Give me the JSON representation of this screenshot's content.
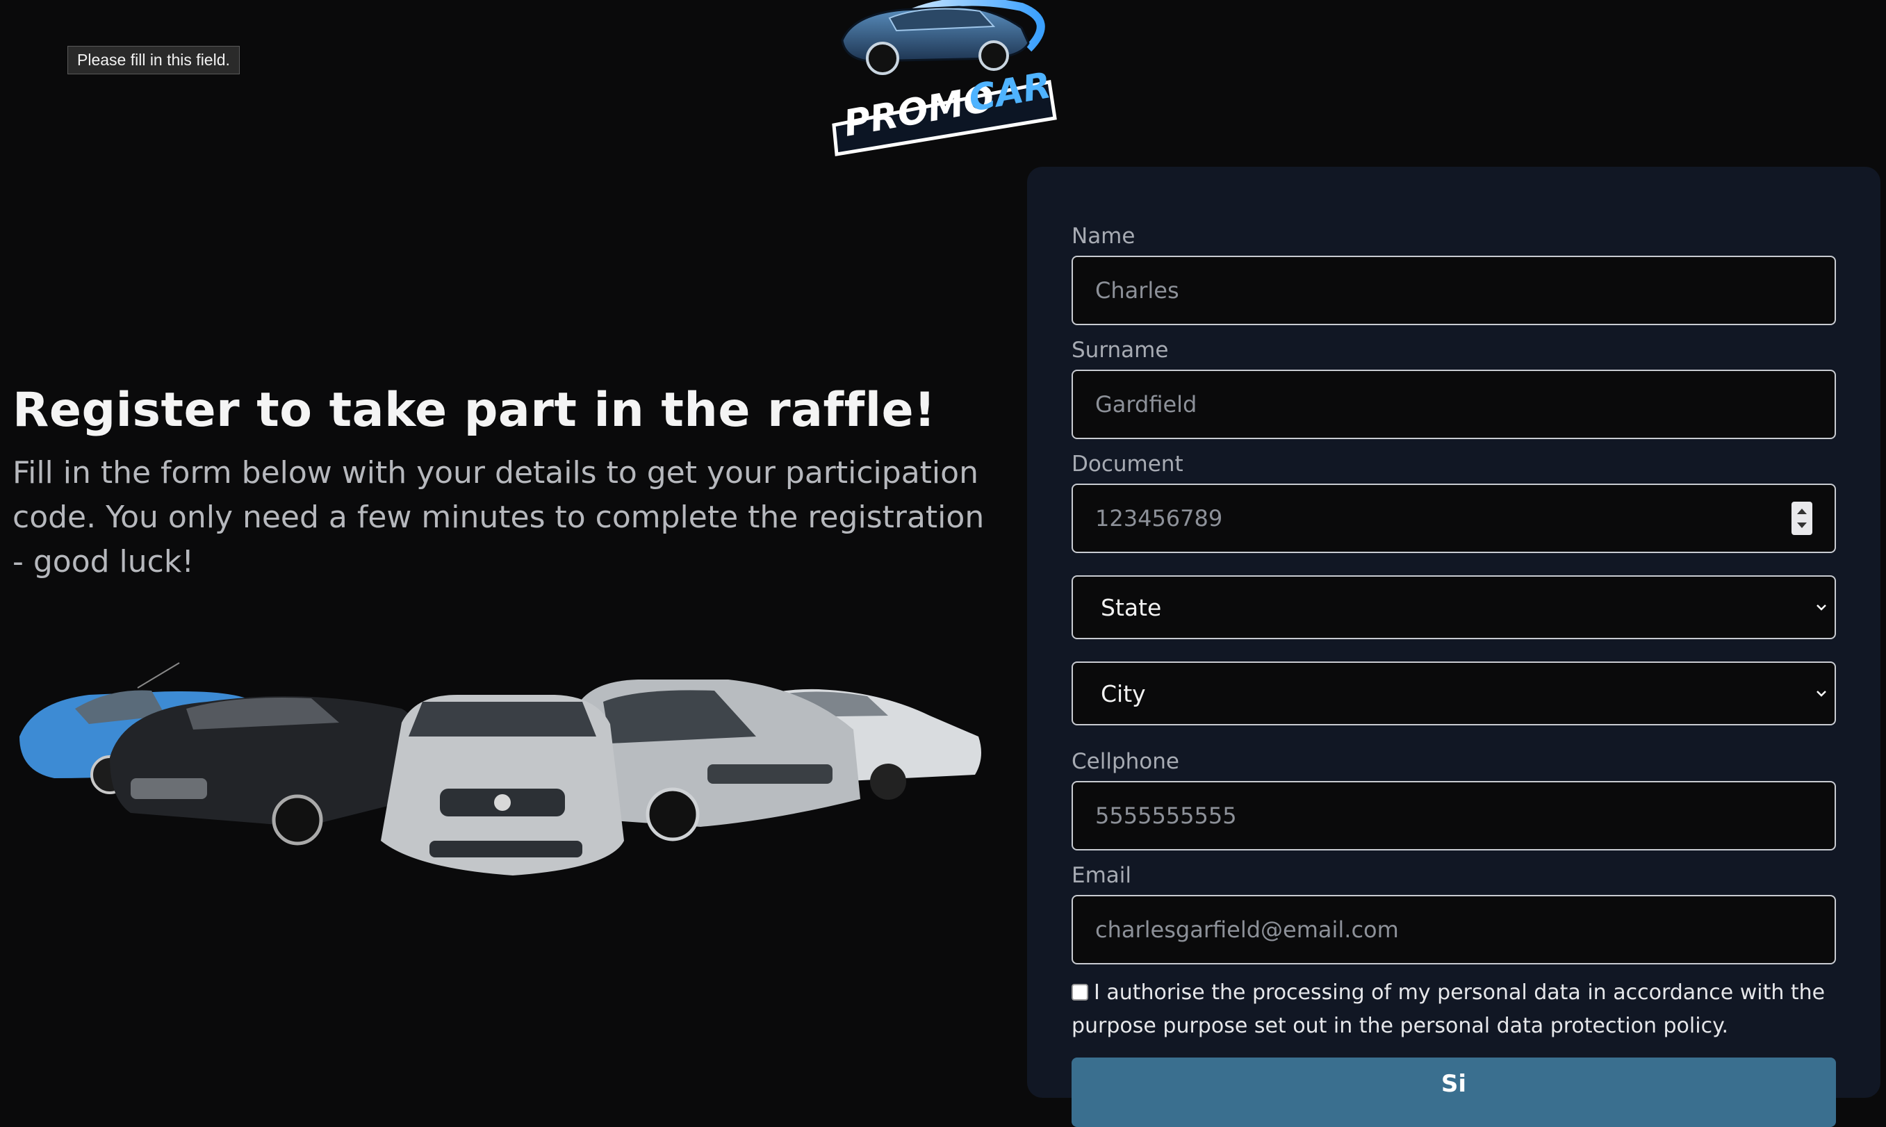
{
  "tooltip": {
    "text": "Please fill in this field."
  },
  "logo": {
    "text": "PROMO-CAR"
  },
  "hero": {
    "title": "Register to take part in the raffle!",
    "subtitle": "Fill in the form below with your details to get your participation code. You only need a few minutes to complete the registration - good luck!"
  },
  "form": {
    "name": {
      "label": "Name",
      "value": "Charles"
    },
    "surname": {
      "label": "Surname",
      "value": "Gardfield"
    },
    "document": {
      "label": "Document",
      "value": "123456789"
    },
    "state": {
      "selected": "State"
    },
    "city": {
      "selected": "City"
    },
    "cellphone": {
      "label": "Cellphone",
      "value": "5555555555"
    },
    "email": {
      "label": "Email",
      "value": "charlesgarfield@email.com"
    },
    "consent": {
      "text": "I authorise the processing of my personal data in accordance with the purpose purpose set out in the personal data protection policy.",
      "checked": false
    },
    "submit_label": "Si"
  },
  "colors": {
    "background": "#0a0a0b",
    "panel": "#111724",
    "button": "#3a6f8f",
    "logo_blue": "#4fb3ff"
  },
  "icons": [
    "chevron-down-icon",
    "stepper-arrows-icon",
    "checkbox-icon"
  ]
}
